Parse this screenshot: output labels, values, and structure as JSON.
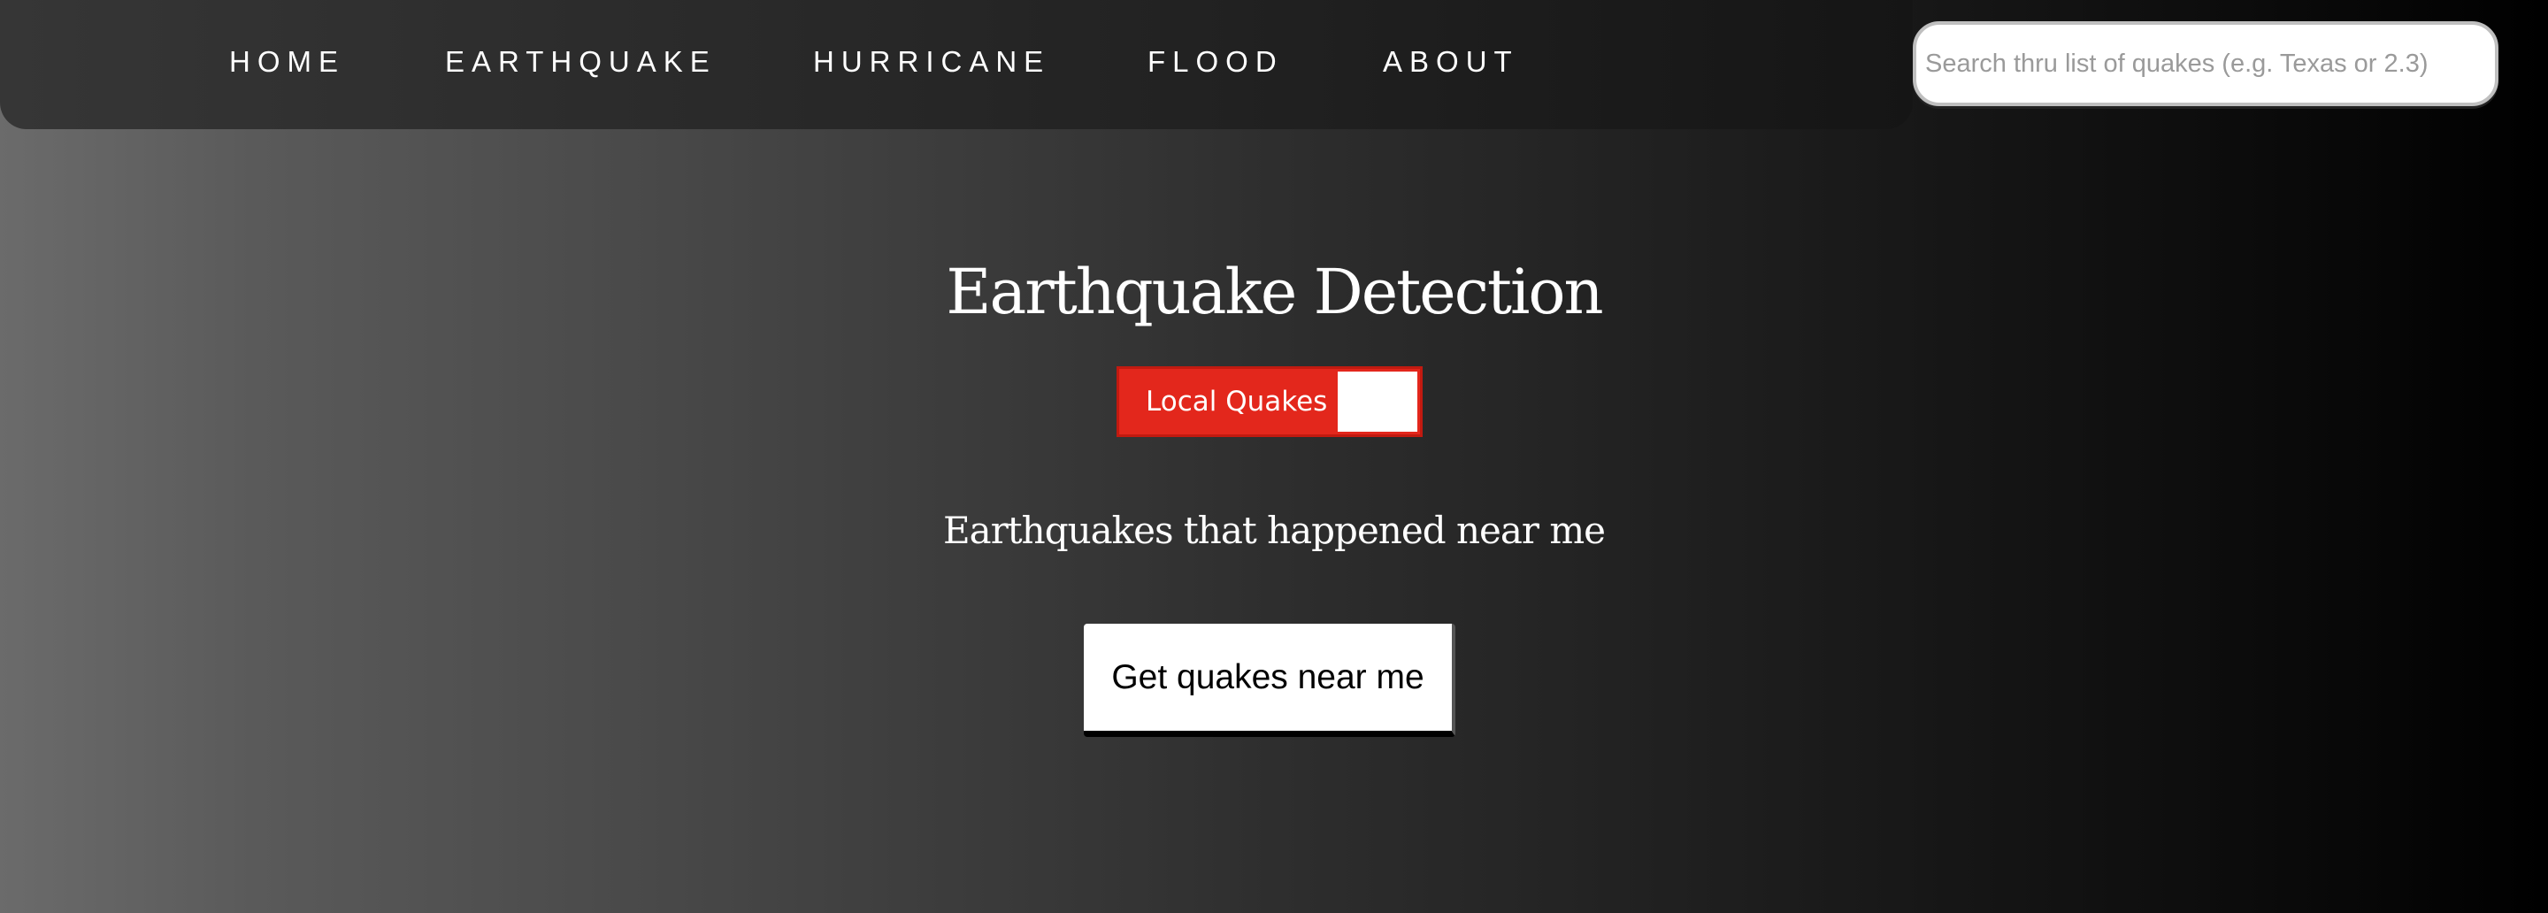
{
  "nav": {
    "items": [
      {
        "label": "HOME"
      },
      {
        "label": "EARTHQUAKE"
      },
      {
        "label": "HURRICANE"
      },
      {
        "label": "FLOOD"
      },
      {
        "label": "ABOUT"
      }
    ]
  },
  "search": {
    "placeholder": "Search thru list of quakes (e.g. Texas or 2.3)",
    "value": ""
  },
  "main": {
    "title": "Earthquake Detection",
    "toggle": {
      "label": "Local Quakes",
      "state": "on",
      "color": "#e3271c"
    },
    "subtitle": "Earthquakes that happened near me",
    "action_button": "Get quakes near me"
  }
}
